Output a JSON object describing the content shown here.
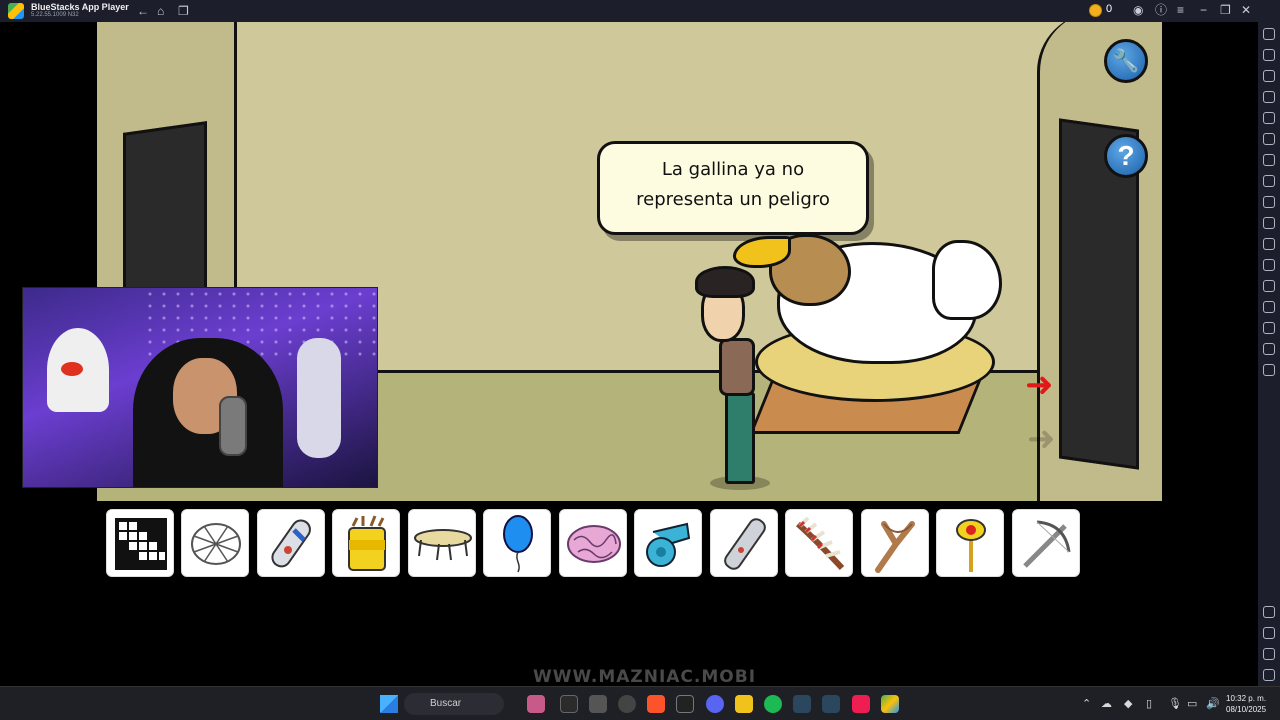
{
  "window": {
    "title": "BlueStacks App Player",
    "subtitle": "5.22.55.1009  N32",
    "coin_count": "0",
    "nav_back_icon": "back-arrow-icon",
    "nav_home_icon": "home-icon",
    "nav_tabs_icon": "tabs-icon"
  },
  "game": {
    "speech_line_1": "La gallina ya no",
    "speech_line_2": "representa un peligro",
    "settings_icon": "wrench-icon",
    "help_label": "?",
    "exit_arrow_icon": "red-arrow-icon"
  },
  "inventory": {
    "items": [
      {
        "name": "crossword-puzzle"
      },
      {
        "name": "net"
      },
      {
        "name": "skateboard-deck"
      },
      {
        "name": "yellow-bucket-sticks"
      },
      {
        "name": "trampoline"
      },
      {
        "name": "blue-balloon"
      },
      {
        "name": "brain"
      },
      {
        "name": "whistle"
      },
      {
        "name": "lighter"
      },
      {
        "name": "feather-headdress"
      },
      {
        "name": "slingshot"
      },
      {
        "name": "plunger-flower"
      },
      {
        "name": "crossbow"
      }
    ]
  },
  "watermark": "WWW.MAZNIAC.MOBI",
  "taskbar": {
    "search_placeholder": "Buscar",
    "time": "10:32 p. m.",
    "date": "08/10/2025"
  },
  "colors": {
    "wall": "#cfc89a",
    "floor": "#b4b37a",
    "speech_bg": "#fdfbe0",
    "button_blue": "#2b78c8",
    "arrow_red": "#e01818"
  }
}
